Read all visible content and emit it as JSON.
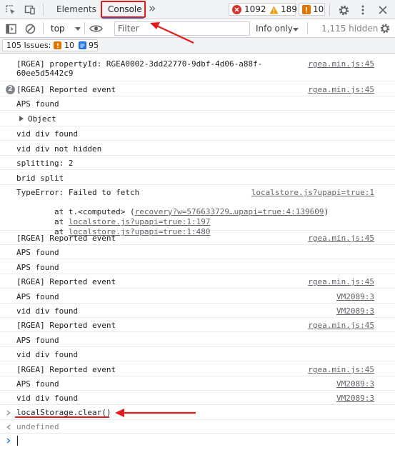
{
  "tabbar": {
    "elements_label": "Elements",
    "console_label": "Console",
    "more_tabs": "»",
    "error_count": "1092",
    "warning_count": "189",
    "info_count": "10"
  },
  "toolbar": {
    "context": "top",
    "filter_placeholder": "Filter",
    "levels": "Info only",
    "hidden": "1,115 hidden"
  },
  "issues": {
    "label": "105 Issues:",
    "warnings": "10",
    "infos": "95"
  },
  "messages": [
    {
      "text": "[RGEA] propertyId: RGEA0002-3dd22770-9dbf-4d06-a88f-\n60ee5d5442c9",
      "source": "rgea.min.js:45"
    },
    {
      "count": "2",
      "text": "[RGEA] Reported event",
      "source": "rgea.min.js:45"
    },
    {
      "text": "APS found"
    },
    {
      "text": "Object"
    },
    {
      "text": "vid div found"
    },
    {
      "text": "vid div not hidden"
    },
    {
      "text": "splitting: 2"
    },
    {
      "text": "brid split"
    },
    {
      "error_head": "TypeError: Failed to fetch",
      "source": "localstore.js?upapi=true:1",
      "stack1_prefix": "    at t.<computed> (",
      "stack1_link": "recovery?w=576633729…upapi=true:4:139609",
      "stack1_suffix": ")",
      "stack2_prefix": "    at ",
      "stack2_link": "localstore.js?upapi=true:1:197",
      "stack3_prefix": "    at ",
      "stack3_link": "localstore.js?upapi=true:1:480"
    },
    {
      "text": "[RGEA] Reported event",
      "source": "rgea.min.js:45"
    },
    {
      "text": "APS found"
    },
    {
      "text": "APS found"
    },
    {
      "text": "[RGEA] Reported event",
      "source": "rgea.min.js:45"
    },
    {
      "text": "APS found",
      "source": "VM2089:3"
    },
    {
      "text": "vid div found",
      "source": "VM2089:3"
    },
    {
      "text": "[RGEA] Reported event",
      "source": "rgea.min.js:45"
    },
    {
      "text": "APS found"
    },
    {
      "text": "vid div found"
    },
    {
      "text": "[RGEA] Reported event",
      "source": "rgea.min.js:45"
    },
    {
      "text": "APS found",
      "source": "VM2089:3"
    },
    {
      "text": "vid div found",
      "source": "VM2089:3"
    }
  ],
  "input_echo": "localStorage.clear()",
  "result": "undefined",
  "colors": {
    "annotation_red": "#e01b1b",
    "error_red": "#d93025",
    "warning_yellow": "#f29900",
    "info_blue": "#1a73e8",
    "issue_orange": "#e37400",
    "prompt_blue": "#1a73e8"
  }
}
